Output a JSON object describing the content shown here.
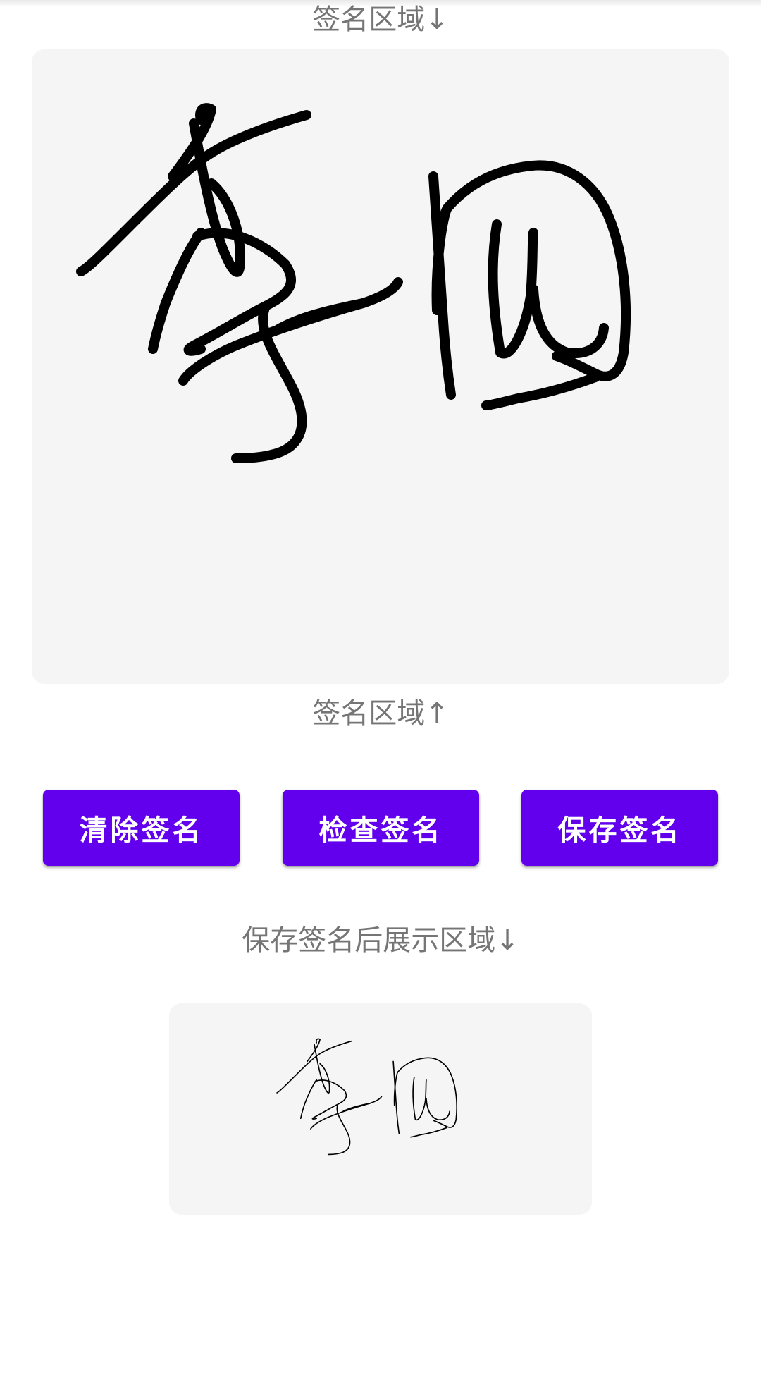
{
  "signature_area": {
    "top_caption": "签名区域↓",
    "bottom_caption": "签名区域↑"
  },
  "actions": {
    "clear_label": "清除签名",
    "check_label": "检查签名",
    "save_label": "保存签名"
  },
  "saved_preview": {
    "caption": "保存签名后展示区域↓"
  },
  "colors": {
    "accent": "#6200ee",
    "pad_background": "#f5f5f5",
    "ink": "#000000",
    "caption_text": "#757575"
  }
}
